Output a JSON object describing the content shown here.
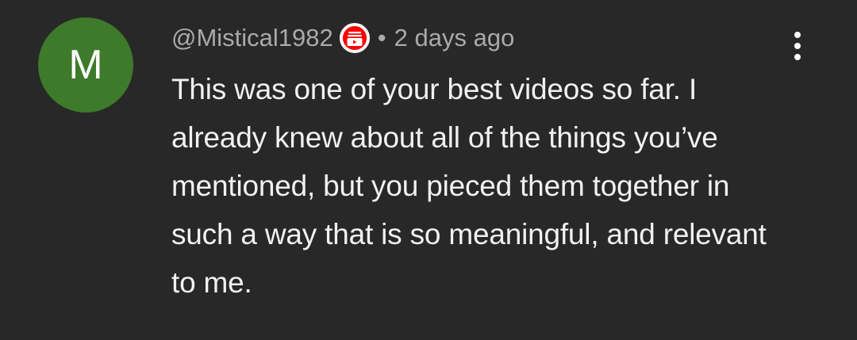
{
  "comment": {
    "avatar": {
      "initial": "M",
      "background_color": "#3d7a2a"
    },
    "author": "@Mistical1982",
    "badge": {
      "icon": "red-circle-shopping-icon",
      "color": "#ff0000"
    },
    "separator": "•",
    "timestamp": "2 days ago",
    "text": "This was one of your best videos so far. I already knew about all of the things you’ve mentioned, but you pieced them together in such a way that is so meaningful, and relevant to me.",
    "menu_icon": "vertical-ellipsis-icon"
  },
  "colors": {
    "background": "#282828",
    "primary_text": "#f1f1f1",
    "secondary_text": "#aaaaaa"
  }
}
